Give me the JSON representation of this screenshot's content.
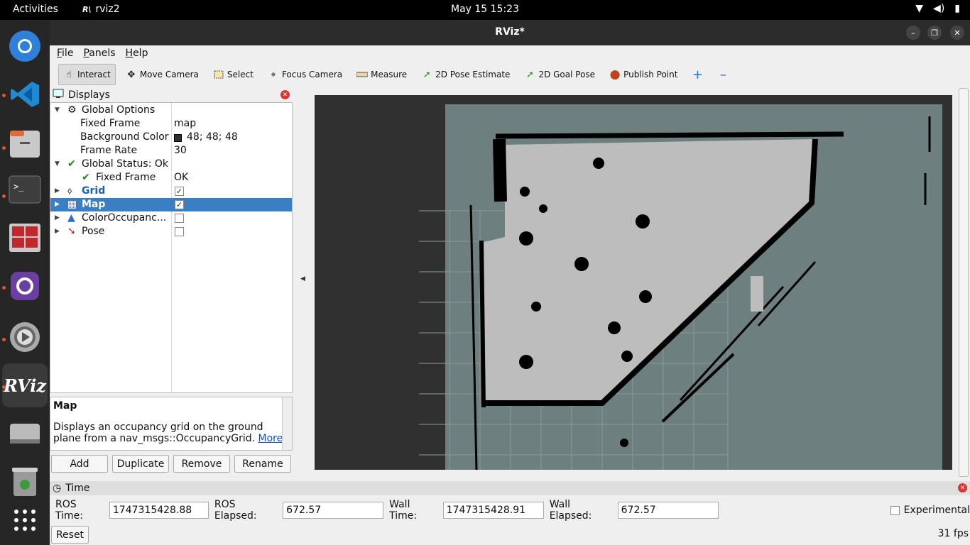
{
  "topbar": {
    "activities": "Activities",
    "app_name": "rviz2",
    "clock": "May 15  15:23"
  },
  "window": {
    "title": "RViz*"
  },
  "menu": {
    "file": "File",
    "panels": "Panels",
    "help": "Help"
  },
  "toolbar": {
    "interact": "Interact",
    "move_camera": "Move Camera",
    "select": "Select",
    "focus_camera": "Focus Camera",
    "measure": "Measure",
    "pose_estimate": "2D Pose Estimate",
    "goal_pose": "2D Goal Pose",
    "publish_point": "Publish Point"
  },
  "displays": {
    "title": "Displays",
    "global_options": "Global Options",
    "fixed_frame_label": "Fixed Frame",
    "fixed_frame_value": "map",
    "background_label": "Background Color",
    "background_value": "48; 48; 48",
    "frame_rate_label": "Frame Rate",
    "frame_rate_value": "30",
    "global_status": "Global Status: Ok",
    "status_fixed_frame": "Fixed Frame",
    "status_fixed_value": "OK",
    "items": [
      {
        "label": "Grid",
        "checked": true
      },
      {
        "label": "Map",
        "checked": true
      },
      {
        "label": "ColorOccupanc...",
        "checked": false
      },
      {
        "label": "Pose",
        "checked": false
      }
    ]
  },
  "description": {
    "title": "Map",
    "text": "Displays an occupancy grid on the ground plane from a nav_msgs::OccupancyGrid.",
    "link": "More"
  },
  "buttons": {
    "add": "Add",
    "duplicate": "Duplicate",
    "remove": "Remove",
    "rename": "Rename"
  },
  "time": {
    "title": "Time",
    "ros_time_label": "ROS Time:",
    "ros_time": "1747315428.88",
    "ros_elapsed_label": "ROS Elapsed:",
    "ros_elapsed": "672.57",
    "wall_time_label": "Wall Time:",
    "wall_time": "1747315428.91",
    "wall_elapsed_label": "Wall Elapsed:",
    "wall_elapsed": "672.57",
    "experimental": "Experimental",
    "reset": "Reset",
    "fps": "31 fps"
  },
  "colors": {
    "accent": "#3a7fc3",
    "map_unknown": "#6e7f7f",
    "map_free": "#bdbdbd",
    "background": "#303030"
  }
}
